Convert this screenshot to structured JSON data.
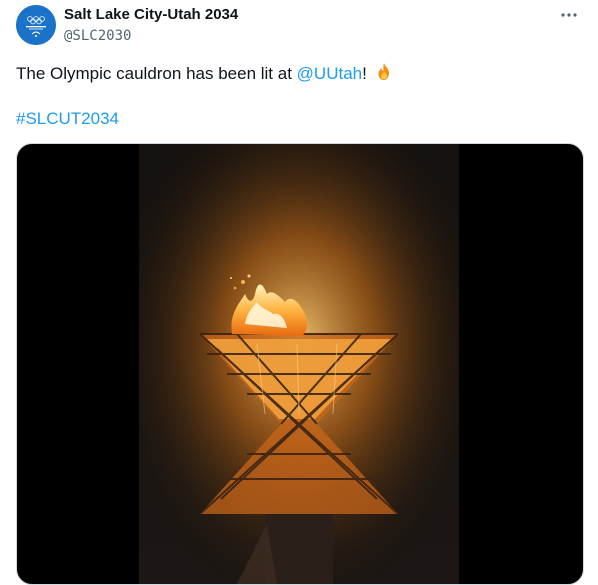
{
  "tweet": {
    "display_name": "Salt Lake City-Utah 2034",
    "handle": "@SLC2030",
    "text_before_mention": "The Olympic cauldron has been lit at ",
    "mention": "@UUtah",
    "text_after_mention": "!",
    "emoji": "🔥",
    "hashtag": "#SLCUT2034"
  },
  "icons": {
    "avatar": "slc-2034-logo",
    "more": "more-horizontal-icon",
    "emoji": "fire-icon"
  },
  "colors": {
    "link": "#1d9bf0",
    "avatar_bg": "#1a73c8",
    "media_bg": "#000000"
  },
  "media": {
    "type": "video",
    "subject": "olympic-cauldron-flame"
  }
}
